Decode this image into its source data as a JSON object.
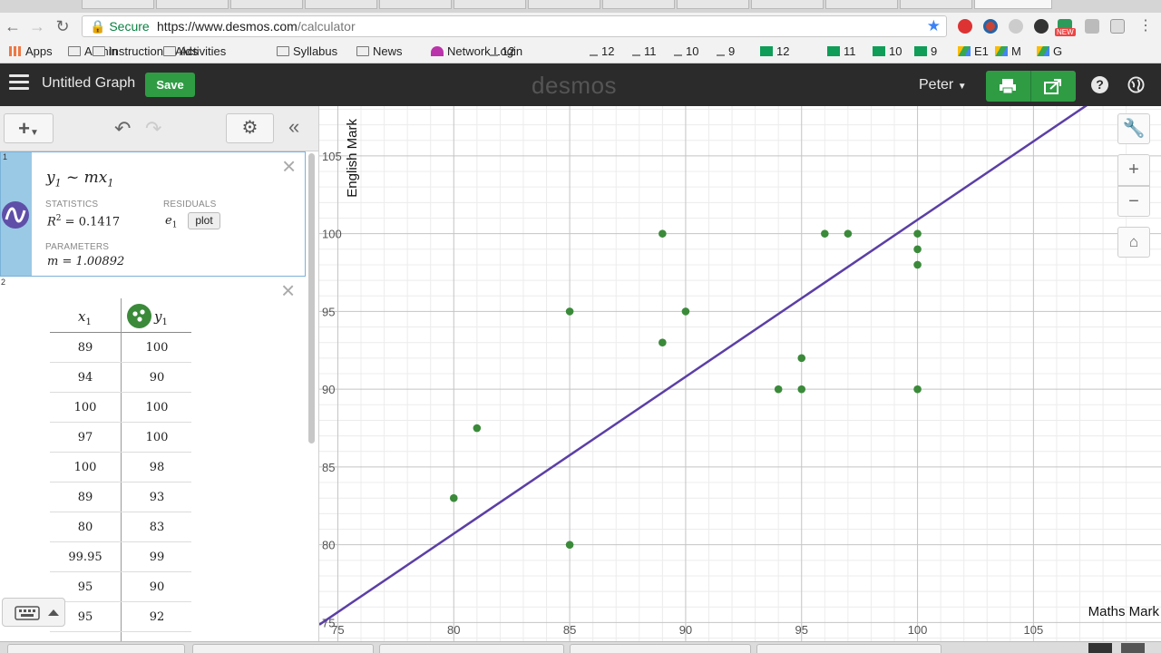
{
  "browser": {
    "secure_label": "Secure",
    "url_scheme_host": "https://www.desmos.com",
    "url_path": "/calculator",
    "new_badge": "NEW",
    "bookmarks": [
      {
        "label": "Apps",
        "icon": "apps-grid-icon"
      },
      {
        "label": "Admin",
        "icon": "folder-icon"
      },
      {
        "label": "Instructional Aids",
        "icon": "folder-icon"
      },
      {
        "label": "Activities",
        "icon": "folder-icon"
      },
      {
        "label": "Syllabus",
        "icon": "folder-icon"
      },
      {
        "label": "News",
        "icon": "folder-icon"
      },
      {
        "label": "Network Login",
        "icon": "umbrella-icon"
      },
      {
        "label": "12",
        "icon": "download-icon"
      },
      {
        "label": "12",
        "icon": "download-icon"
      },
      {
        "label": "11",
        "icon": "download-icon"
      },
      {
        "label": "10",
        "icon": "download-icon"
      },
      {
        "label": "9",
        "icon": "download-icon"
      },
      {
        "label": "12",
        "icon": "sheets-icon"
      },
      {
        "label": "11",
        "icon": "sheets-icon"
      },
      {
        "label": "10",
        "icon": "sheets-icon"
      },
      {
        "label": "9",
        "icon": "sheets-icon"
      },
      {
        "label": "E1",
        "icon": "drive-icon"
      },
      {
        "label": "M",
        "icon": "drive-icon"
      },
      {
        "label": "G",
        "icon": "drive-icon"
      }
    ]
  },
  "header": {
    "graph_title": "Untitled Graph",
    "save_label": "Save",
    "logo": "desmos",
    "user_name": "Peter"
  },
  "expressions": {
    "regression": {
      "row_number": "1",
      "formula_y": "y",
      "formula_sub": "1",
      "formula_rest": " ~ mx",
      "statistics_label": "STATISTICS",
      "residuals_label": "RESIDUALS",
      "r2_prefix": "R",
      "r2_value": " = 0.1417",
      "residual_var": "e",
      "residual_sub": "1",
      "plot_label": "plot",
      "parameters_label": "PARAMETERS",
      "m_value": "m = 1.00892"
    },
    "table": {
      "row_number": "2",
      "col1_var": "x",
      "col2_var": "y",
      "col_sub": "1",
      "rows": [
        [
          "89",
          "100"
        ],
        [
          "94",
          "90"
        ],
        [
          "100",
          "100"
        ],
        [
          "97",
          "100"
        ],
        [
          "100",
          "98"
        ],
        [
          "89",
          "93"
        ],
        [
          "80",
          "83"
        ],
        [
          "99.95",
          "99"
        ],
        [
          "95",
          "90"
        ],
        [
          "95",
          "92"
        ]
      ]
    }
  },
  "colors": {
    "points": "#3a8a3a",
    "line": "#5b3fa6",
    "save_green": "#2f9c44"
  },
  "chart_data": {
    "type": "scatter",
    "xlabel": "Maths Mark",
    "ylabel": "English Mark",
    "xlim": [
      74.2,
      110.5
    ],
    "ylim": [
      73.8,
      108.2
    ],
    "x_ticks": [
      75,
      80,
      85,
      90,
      95,
      100,
      105
    ],
    "y_ticks": [
      75,
      80,
      85,
      90,
      95,
      100,
      105
    ],
    "grid": true,
    "points": [
      [
        80,
        83
      ],
      [
        81,
        87.5
      ],
      [
        85,
        95
      ],
      [
        85,
        80
      ],
      [
        89,
        100
      ],
      [
        89,
        93
      ],
      [
        90,
        95
      ],
      [
        94,
        90
      ],
      [
        95,
        92
      ],
      [
        95,
        90
      ],
      [
        96,
        100
      ],
      [
        97,
        100
      ],
      [
        100,
        100
      ],
      [
        100,
        99
      ],
      [
        100,
        98
      ],
      [
        100,
        90
      ]
    ],
    "regression": {
      "model": "y1 ~ m x1",
      "m": 1.00892,
      "r2": 0.1417
    }
  }
}
